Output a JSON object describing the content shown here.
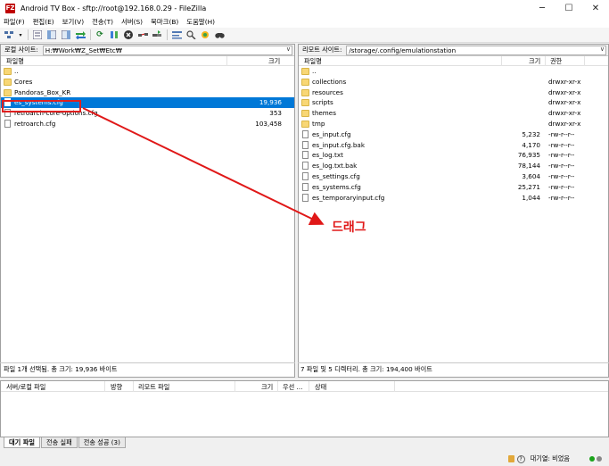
{
  "window": {
    "icon_text": "FZ",
    "title": "Android TV Box - sftp://root@192.168.0.29 - FileZilla",
    "minimize": "─",
    "maximize": "☐",
    "close": "✕"
  },
  "menu": [
    "파일(F)",
    "편집(E)",
    "보기(V)",
    "전송(T)",
    "서버(S)",
    "북마크(B)",
    "도움말(H)"
  ],
  "toolbar_icons": [
    "site-manager-icon",
    "dropdown-icon",
    "message-log-icon",
    "local-tree-icon",
    "remote-tree-icon",
    "queue-icon",
    "refresh-icon",
    "process-queue-icon",
    "cancel-icon",
    "disconnect-icon",
    "reconnect-icon",
    "filter-icon",
    "compare-icon",
    "sync-browse-icon",
    "search-icon"
  ],
  "local": {
    "site_label": "로컬 사이트:",
    "site_path": "H:₩Work₩Z_Set₩Etc₩",
    "col_name": "파일명",
    "col_size": "크기",
    "files": [
      {
        "name": "..",
        "size": "",
        "type": "folder"
      },
      {
        "name": "Cores",
        "size": "",
        "type": "folder"
      },
      {
        "name": "Pandoras_Box_KR",
        "size": "",
        "type": "folder"
      },
      {
        "name": "es_systems.cfg",
        "size": "19,936",
        "type": "file",
        "selected": true
      },
      {
        "name": "retroarch-core-options.cfg",
        "size": "353",
        "type": "file"
      },
      {
        "name": "retroarch.cfg",
        "size": "103,458",
        "type": "file"
      }
    ],
    "status": "파일 1개 선택됨. 총 크기: 19,936 바이트"
  },
  "remote": {
    "site_label": "리모트 사이트:",
    "site_path": "/storage/.config/emulationstation",
    "col_name": "파일명",
    "col_size": "크기",
    "col_perm": "권한",
    "files": [
      {
        "name": "..",
        "size": "",
        "perm": "",
        "type": "folder"
      },
      {
        "name": "collections",
        "size": "",
        "perm": "drwxr-xr-x",
        "type": "folder"
      },
      {
        "name": "resources",
        "size": "",
        "perm": "drwxr-xr-x",
        "type": "folder"
      },
      {
        "name": "scripts",
        "size": "",
        "perm": "drwxr-xr-x",
        "type": "folder"
      },
      {
        "name": "themes",
        "size": "",
        "perm": "drwxr-xr-x",
        "type": "folder"
      },
      {
        "name": "tmp",
        "size": "",
        "perm": "drwxr-xr-x",
        "type": "folder"
      },
      {
        "name": "es_input.cfg",
        "size": "5,232",
        "perm": "-rw-r--r--",
        "type": "file"
      },
      {
        "name": "es_input.cfg.bak",
        "size": "4,170",
        "perm": "-rw-r--r--",
        "type": "file"
      },
      {
        "name": "es_log.txt",
        "size": "76,935",
        "perm": "-rw-r--r--",
        "type": "file"
      },
      {
        "name": "es_log.txt.bak",
        "size": "78,144",
        "perm": "-rw-r--r--",
        "type": "file"
      },
      {
        "name": "es_settings.cfg",
        "size": "3,604",
        "perm": "-rw-r--r--",
        "type": "file"
      },
      {
        "name": "es_systems.cfg",
        "size": "25,271",
        "perm": "-rw-r--r--",
        "type": "file"
      },
      {
        "name": "es_temporaryinput.cfg",
        "size": "1,044",
        "perm": "-rw-r--r--",
        "type": "file"
      }
    ],
    "status": "7 파일 및 5 디렉터리. 총 크기: 194,400 바이트"
  },
  "queue": {
    "col_local": "서버/로컬 파일",
    "col_dir": "방향",
    "col_remote": "리모트 파일",
    "col_size": "크기",
    "col_priority": "우선 ...",
    "col_status": "상태"
  },
  "tabs": [
    "대기 파일",
    "전송 실패",
    "전송 성공 (3)"
  ],
  "bottom": {
    "queue_status": "대기열: 비었음",
    "q_icon_text": "?",
    "dot_colors": [
      "#1aa31a",
      "#888888"
    ]
  },
  "annotation": {
    "drag_label": "드래그",
    "color": "#e01818"
  }
}
